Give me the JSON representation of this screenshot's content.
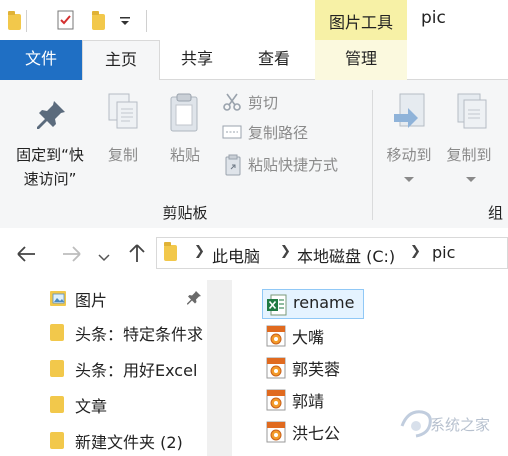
{
  "titlebar": {
    "picture_tools": "图片工具",
    "window_title": "pic"
  },
  "tabs": {
    "file": "文件",
    "home": "主页",
    "share": "共享",
    "view": "查看",
    "manage": "管理"
  },
  "ribbon": {
    "pin_line1": "固定到“快",
    "pin_line2": "速访问”",
    "copy": "复制",
    "paste": "粘贴",
    "cut": "剪切",
    "copy_path": "复制路径",
    "paste_shortcut": "粘贴快捷方式",
    "move_to": "移动到",
    "copy_to": "复制到",
    "clipboard_group": "剪贴板",
    "organize_group_partial": "组"
  },
  "address": {
    "this_pc": "此电脑",
    "local_disk": "本地磁盘 (C:)",
    "folder": "pic"
  },
  "navpane": {
    "items": [
      {
        "label": "图片"
      },
      {
        "label": "头条：特定条件求"
      },
      {
        "label": "头条：用好Excel"
      },
      {
        "label": "文章"
      },
      {
        "label": "新建文件夹 (2)"
      }
    ]
  },
  "files": [
    {
      "name": "rename",
      "type": "excel"
    },
    {
      "name": "大嘴",
      "type": "jpg"
    },
    {
      "name": "郭芙蓉",
      "type": "jpg"
    },
    {
      "name": "郭靖",
      "type": "jpg"
    },
    {
      "name": "洪七公",
      "type": "jpg"
    }
  ],
  "watermark": {
    "text": "系统之家"
  }
}
